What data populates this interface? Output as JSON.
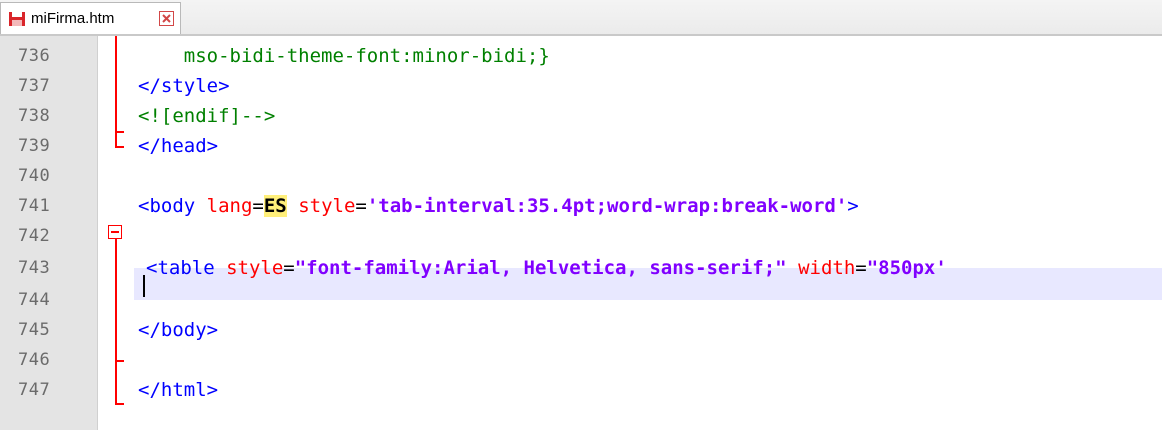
{
  "tab": {
    "label": "miFirma.htm"
  },
  "lines": [
    {
      "num": "736"
    },
    {
      "num": "737"
    },
    {
      "num": "738"
    },
    {
      "num": "739"
    },
    {
      "num": "740"
    },
    {
      "num": "741"
    },
    {
      "num": "742"
    },
    {
      "num": "743"
    },
    {
      "num": "744"
    },
    {
      "num": "745"
    },
    {
      "num": "746"
    },
    {
      "num": "747"
    }
  ],
  "code": {
    "l736": "    mso-bidi-theme-font:minor-bidi;}",
    "l737": "</style>",
    "l738": "<![endif]-->",
    "l739": "</head>",
    "l741_tag_open": "<body",
    "l741_attr1": " lang",
    "l741_eq1": "=",
    "l741_val1": "ES",
    "l741_attr2": " style",
    "l741_eq2": "=",
    "l741_str2": "'tab-interval:35.4pt;word-wrap:break-word'",
    "l741_close": ">",
    "l743_tag_open": "<table",
    "l743_attr1": " style",
    "l743_eq1": "=",
    "l743_str1": "\"font-family:Arial, Helvetica, sans-serif;\"",
    "l743_attr2": " width",
    "l743_eq2": "=",
    "l743_str2": "\"850px'",
    "l745": "</body>",
    "l747": "</html>"
  },
  "colors": {
    "tag": "#0000ff",
    "attribute": "#ff0000",
    "string": "#8000ff",
    "comment": "#008000",
    "current_line": "#e8e8ff",
    "fold_marker": "#ff0000"
  },
  "icons": {
    "tab_file": "save-disk-icon",
    "tab_close": "close-x-icon",
    "fold": "fold-minus-icon"
  }
}
